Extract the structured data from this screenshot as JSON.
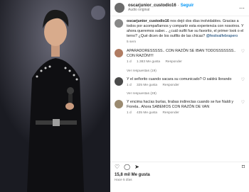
{
  "post": {
    "username": "oscarjunior_custodio16",
    "audio": "Audio original",
    "follow_label": "Seguir",
    "caption_user": "oscarjunior_custodio16",
    "caption": "nos dejó dos días inolvidables. Gracias a todos por acompañarnos y compartir esta experiencia con nosotros. Y ahora queremos saber... ¿cuál outfit fue su favorito, el primer look o el terno? ¿Qué dicen de los outfits de las chicas?",
    "caption_mention": "@festivalfebrapero",
    "caption_time": "5 sem"
  },
  "comments": [
    {
      "text": "APARADORESSSSS.. CON RAZÓN SE IBAN TODOSSSSSSS.. CON RAZÓN!!!!",
      "time": "1 d",
      "likes": "1.383 Me gusta",
      "reply": "Responder",
      "replies": "Ver respuestas (19)"
    },
    {
      "text": "Y el señorito cuando sacara su comunicado? O saldrá llorando",
      "time": "1 d",
      "likes": "325 Me gusta",
      "reply": "Responder",
      "replies": "Ver respuestas (28)"
    },
    {
      "text": "Y encima hacías burlas, lirabas indirectas cuando se fue Naldi y Fiorela.. Ahora SABEMOS CON RAZÓN DE VAN",
      "time": "1 d",
      "likes": "435 Me gusta",
      "reply": "Responder"
    }
  ],
  "footer": {
    "likes": "15,8 mil Me gusta",
    "ago": "Hace 5 días"
  },
  "icons": {
    "like": "heart-icon",
    "comment": "comment-icon",
    "share": "share-icon",
    "save": "bookmark-icon"
  }
}
